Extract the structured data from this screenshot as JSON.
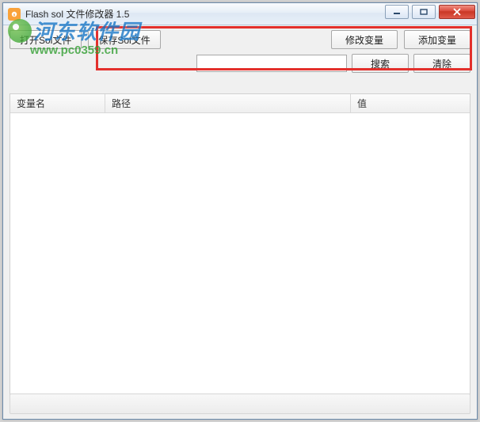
{
  "window": {
    "title": "Flash sol 文件修改器 1.5"
  },
  "toolbar": {
    "open_label": "打开Sol文件",
    "save_label": "保存Sol文件",
    "modify_var_label": "修改变量",
    "add_var_label": "添加变量",
    "search_label": "搜索",
    "clear_label": "清除",
    "search_value": ""
  },
  "columns": {
    "name": "变量名",
    "path": "路径",
    "value": "值"
  },
  "watermark": {
    "brand": "河东软件园",
    "url": "www.pc0359.cn"
  }
}
